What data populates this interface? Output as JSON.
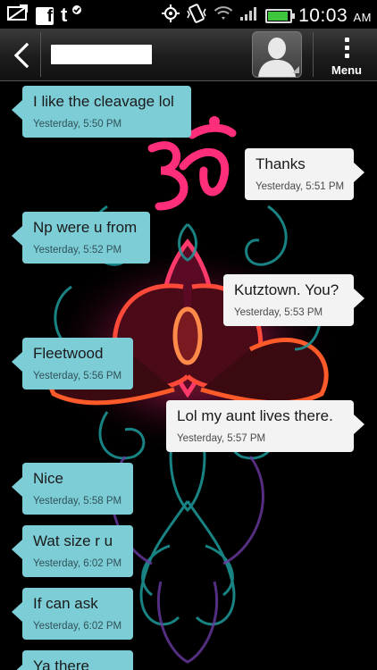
{
  "status_bar": {
    "time": "10:03",
    "ampm": "AM",
    "icons": [
      "mail-icon",
      "facebook-icon",
      "tumblr-icon",
      "gps-icon",
      "vibrate-icon",
      "wifi-icon",
      "signal-icon",
      "battery-icon"
    ],
    "facebook_glyph": "f",
    "tumblr_glyph": "t",
    "battery_color": "#3fc63f"
  },
  "header": {
    "back_icon": "chevron-left-icon",
    "contact_name": "",
    "avatar_icon": "person-silhouette-icon",
    "menu_label": "Menu"
  },
  "colors": {
    "incoming_bubble": "#7dcdd7",
    "outgoing_bubble": "#f3f3f3",
    "background": "#000000"
  },
  "messages": [
    {
      "direction": "in",
      "text": "I like the cleavage lol",
      "time": "Yesterday, 5:50 PM"
    },
    {
      "direction": "out",
      "text": "Thanks",
      "time": "Yesterday, 5:51 PM"
    },
    {
      "direction": "in",
      "text": "Np were u from",
      "time": "Yesterday, 5:52 PM"
    },
    {
      "direction": "out",
      "text": "Kutztown. You?",
      "time": "Yesterday, 5:53 PM"
    },
    {
      "direction": "in",
      "text": "Fleetwood",
      "time": "Yesterday, 5:56 PM"
    },
    {
      "direction": "out",
      "text": "Lol my aunt lives there.",
      "time": "Yesterday, 5:57 PM"
    },
    {
      "direction": "in",
      "text": "Nice",
      "time": "Yesterday, 5:58 PM"
    },
    {
      "direction": "in",
      "text": "Wat size r u",
      "time": "Yesterday, 6:02 PM"
    },
    {
      "direction": "in",
      "text": "If can ask",
      "time": "Yesterday, 6:02 PM"
    },
    {
      "direction": "in",
      "text": "Ya there",
      "time": ""
    }
  ]
}
